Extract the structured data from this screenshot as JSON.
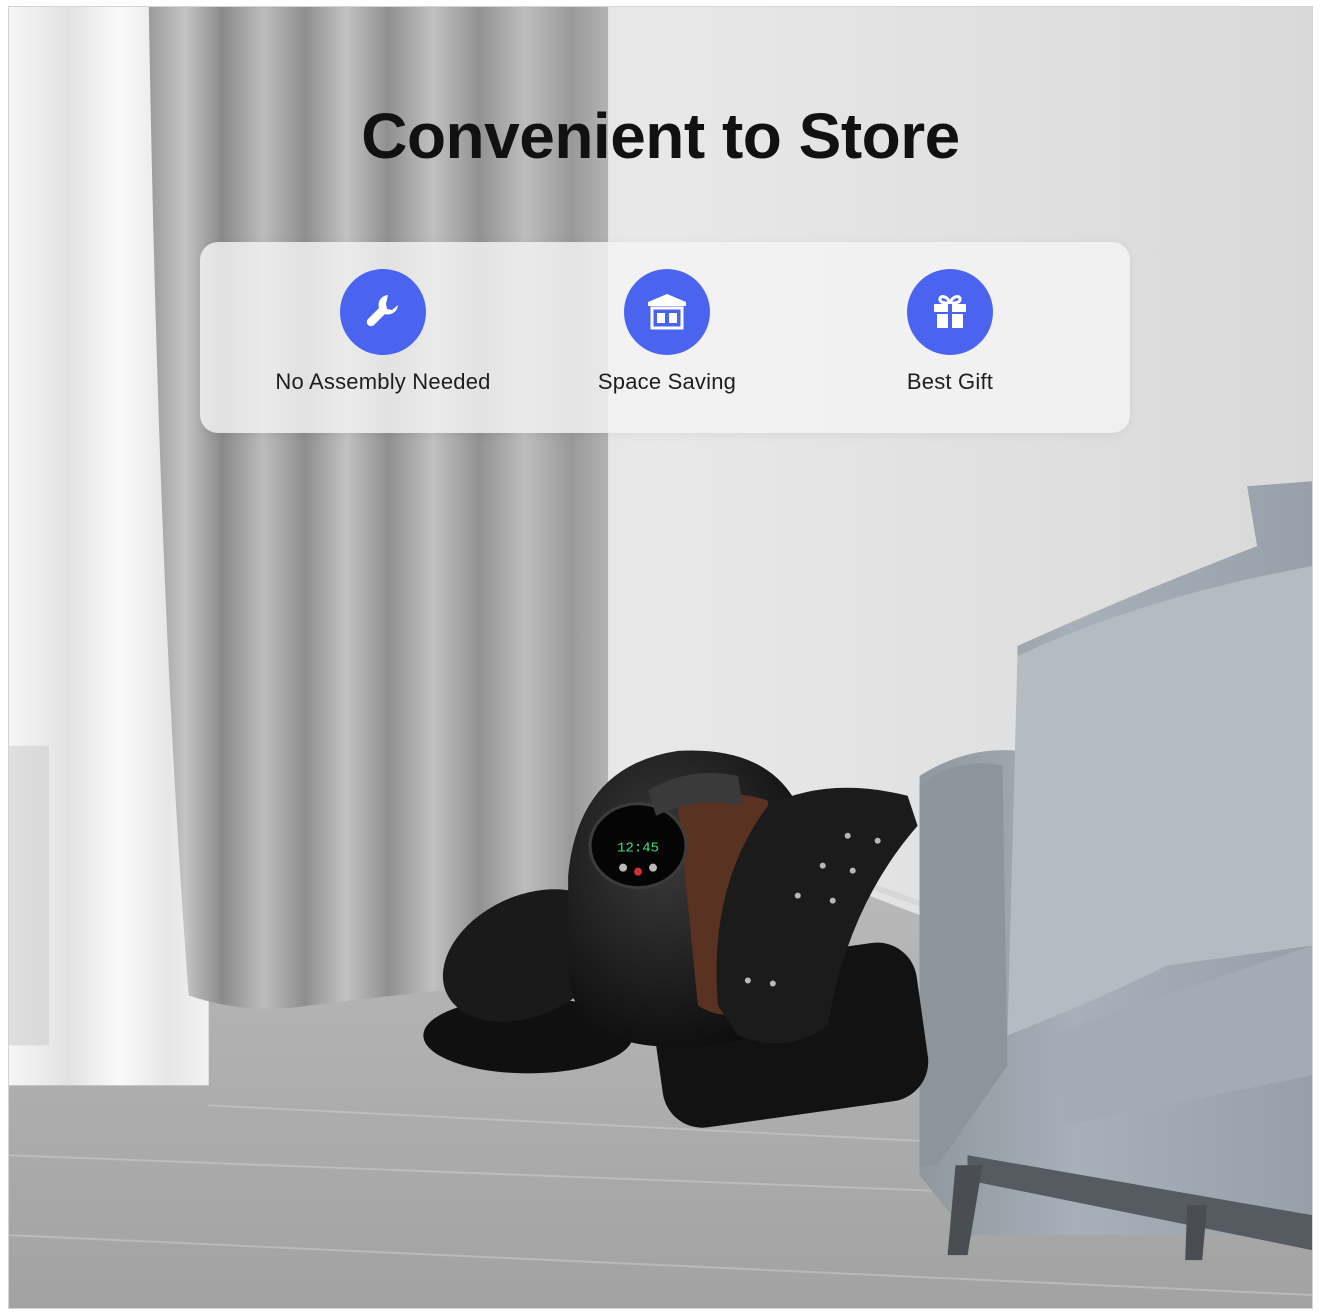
{
  "headline": "Convenient to Store",
  "features": [
    {
      "label": "No Assembly Needed",
      "icon": "wrench-icon"
    },
    {
      "label": "Space Saving",
      "icon": "storage-shelf-icon"
    },
    {
      "label": "Best Gift",
      "icon": "gift-icon"
    }
  ],
  "device": {
    "display": "12:45"
  },
  "colors": {
    "accent": "#4a64f0",
    "headline": "#111111"
  }
}
